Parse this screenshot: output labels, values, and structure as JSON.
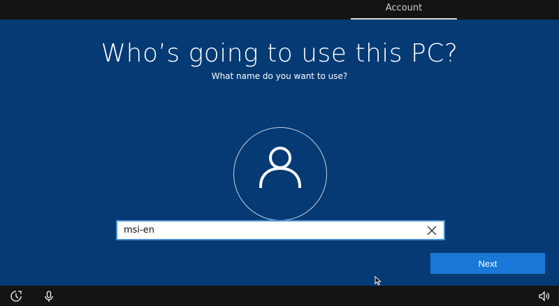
{
  "header": {
    "active_tab": "Account"
  },
  "page": {
    "title": "Who’s going to use this PC?",
    "subtitle": "What name do you want to use?"
  },
  "name_input": {
    "value": "msi-en",
    "clear_icon": "close-icon"
  },
  "actions": {
    "next_label": "Next"
  },
  "footer": {
    "icons": [
      "ease-of-access-icon",
      "microphone-icon",
      "volume-icon"
    ]
  },
  "colors": {
    "background": "#053a74",
    "bars": "#141414",
    "accent_button": "#1a78d6",
    "field_border": "#4a8fd3"
  }
}
